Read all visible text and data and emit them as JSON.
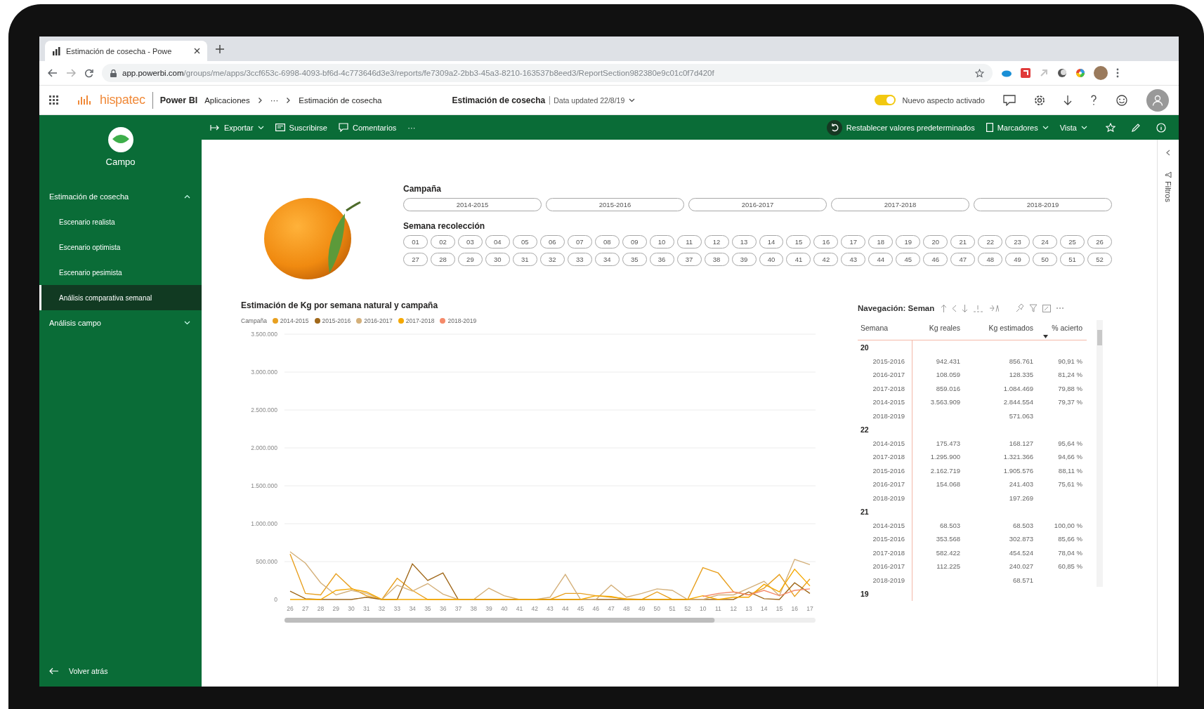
{
  "browser": {
    "tab_title": "Estimación de cosecha - Powe",
    "url_host": "app.powerbi.com",
    "url_path": "/groups/me/apps/3ccf653c-6998-4093-bf6d-4c773646d3e3/reports/fe7309a2-2bb3-45a3-8210-163537b8eed3/ReportSection982380e9c01c0f7d420f"
  },
  "app_bar": {
    "brand": "hispatec",
    "product": "Power BI",
    "breadcrumb": [
      "Aplicaciones",
      "···",
      "Estimación de cosecha"
    ],
    "report_title": "Estimación de cosecha",
    "data_updated": "Data updated 22/8/19",
    "new_look": {
      "label": "Nuevo aspecto activado",
      "on": true
    }
  },
  "toolbar": {
    "left": [
      {
        "label": "Exportar",
        "kind": "export",
        "dropdown": true
      },
      {
        "label": "Suscribirse",
        "kind": "subscribe",
        "dropdown": false
      },
      {
        "label": "Comentarios",
        "kind": "comment",
        "dropdown": false
      },
      {
        "label": "···",
        "kind": "more",
        "dropdown": false
      }
    ],
    "right": [
      {
        "label": "Restablecer valores predeterminados",
        "kind": "reset",
        "dropdown": false
      },
      {
        "label": "Marcadores",
        "kind": "bookmark",
        "dropdown": true
      },
      {
        "label": "Vista",
        "kind": "view",
        "dropdown": true
      }
    ]
  },
  "sidebar": {
    "app_name": "Campo",
    "sections": [
      {
        "label": "Estimación de cosecha",
        "expanded": true,
        "children": [
          {
            "label": "Escenario realista",
            "selected": false
          },
          {
            "label": "Escenario optimista",
            "selected": false
          },
          {
            "label": "Escenario pesimista",
            "selected": false
          },
          {
            "label": "Análisis comparativa semanal",
            "selected": true
          }
        ]
      },
      {
        "label": "Análisis campo",
        "expanded": false
      }
    ],
    "back": "Volver atrás"
  },
  "content": {
    "campaign_slicer": {
      "title": "Campaña",
      "options": [
        {
          "label": "2014-2015",
          "selected": false
        },
        {
          "label": "2015-2016",
          "selected": false
        },
        {
          "label": "2016-2017",
          "selected": false
        },
        {
          "label": "2017-2018",
          "selected": false
        },
        {
          "label": "2018-2019",
          "selected": false
        }
      ]
    },
    "week_slicer": {
      "title": "Semana recolección",
      "options": [
        {
          "label": "01",
          "selected": false
        },
        {
          "label": "02",
          "selected": false
        },
        {
          "label": "03",
          "selected": false
        },
        {
          "label": "04",
          "selected": false
        },
        {
          "label": "05",
          "selected": false
        },
        {
          "label": "06",
          "selected": false
        },
        {
          "label": "07",
          "selected": false
        },
        {
          "label": "08",
          "selected": false
        },
        {
          "label": "09",
          "selected": false
        },
        {
          "label": "10",
          "selected": false
        },
        {
          "label": "11",
          "selected": false
        },
        {
          "label": "12",
          "selected": false
        },
        {
          "label": "13",
          "selected": false
        },
        {
          "label": "14",
          "selected": false
        },
        {
          "label": "15",
          "selected": false
        },
        {
          "label": "16",
          "selected": false
        },
        {
          "label": "17",
          "selected": false
        },
        {
          "label": "18",
          "selected": false
        },
        {
          "label": "19",
          "selected": false
        },
        {
          "label": "20",
          "selected": false
        },
        {
          "label": "21",
          "selected": false
        },
        {
          "label": "22",
          "selected": false
        },
        {
          "label": "23",
          "selected": false
        },
        {
          "label": "24",
          "selected": false
        },
        {
          "label": "25",
          "selected": false
        },
        {
          "label": "26",
          "selected": false
        },
        {
          "label": "27",
          "selected": false
        },
        {
          "label": "28",
          "selected": false
        },
        {
          "label": "29",
          "selected": false
        },
        {
          "label": "30",
          "selected": false
        },
        {
          "label": "31",
          "selected": false
        },
        {
          "label": "32",
          "selected": false
        },
        {
          "label": "33",
          "selected": false
        },
        {
          "label": "34",
          "selected": false
        },
        {
          "label": "35",
          "selected": false
        },
        {
          "label": "36",
          "selected": false
        },
        {
          "label": "37",
          "selected": false
        },
        {
          "label": "38",
          "selected": false
        },
        {
          "label": "39",
          "selected": false
        },
        {
          "label": "40",
          "selected": false
        },
        {
          "label": "41",
          "selected": false
        },
        {
          "label": "42",
          "selected": false
        },
        {
          "label": "43",
          "selected": false
        },
        {
          "label": "44",
          "selected": false
        },
        {
          "label": "45",
          "selected": false
        },
        {
          "label": "46",
          "selected": false
        },
        {
          "label": "47",
          "selected": false
        },
        {
          "label": "48",
          "selected": false
        },
        {
          "label": "49",
          "selected": false
        },
        {
          "label": "50",
          "selected": false
        },
        {
          "label": "51",
          "selected": false
        },
        {
          "label": "52",
          "selected": false
        }
      ]
    },
    "chart": {
      "legend_title": "Campaña",
      "chart_data": {
        "type": "line",
        "grid": true,
        "legend": "top",
        "title": "Estimación de Kg por semana natural y campaña",
        "categories": [
          "26",
          "27",
          "28",
          "29",
          "30",
          "31",
          "32",
          "33",
          "34",
          "35",
          "36",
          "37",
          "38",
          "39",
          "40",
          "41",
          "42",
          "43",
          "44",
          "45",
          "46",
          "47",
          "48",
          "49",
          "50",
          "51",
          "52",
          "10",
          "11",
          "12",
          "13",
          "14",
          "15",
          "16",
          "17"
        ],
        "ylim": [
          0,
          3500000
        ],
        "yticks": [
          {
            "value": 0,
            "label": "0"
          },
          {
            "value": 500000,
            "label": "500.000"
          },
          {
            "value": 1000000,
            "label": "1.000.000"
          },
          {
            "value": 1500000,
            "label": "1.500.000"
          },
          {
            "value": 2000000,
            "label": "2.000.000"
          },
          {
            "value": 2500000,
            "label": "2.500.000"
          },
          {
            "value": 3000000,
            "label": "3.000.000"
          },
          {
            "value": 3500000,
            "label": "3.500.000"
          }
        ],
        "series": [
          {
            "name": "2014-2015",
            "color": "#e8a020",
            "values": [
              600000,
              80000,
              60000,
              340000,
              150000,
              50000,
              0,
              280000,
              120000,
              0,
              0,
              0,
              0,
              0,
              0,
              0,
              0,
              0,
              80000,
              80000,
              50000,
              30000,
              10000,
              0,
              100000,
              0,
              0,
              420000,
              350000,
              100000,
              60000,
              150000,
              330000,
              40000,
              270000
            ]
          },
          {
            "name": "2015-2016",
            "color": "#a0681a",
            "values": [
              110000,
              10000,
              0,
              0,
              0,
              30000,
              0,
              0,
              470000,
              250000,
              350000,
              0,
              0,
              0,
              0,
              0,
              0,
              0,
              0,
              0,
              0,
              0,
              0,
              0,
              0,
              0,
              0,
              0,
              0,
              0,
              100000,
              10000,
              0,
              220000,
              80000
            ]
          },
          {
            "name": "2016-2017",
            "color": "#d4b07a",
            "values": [
              630000,
              480000,
              220000,
              60000,
              120000,
              80000,
              0,
              190000,
              110000,
              210000,
              70000,
              0,
              0,
              150000,
              50000,
              0,
              0,
              30000,
              330000,
              0,
              0,
              190000,
              30000,
              80000,
              140000,
              120000,
              0,
              0,
              60000,
              60000,
              150000,
              240000,
              50000,
              530000,
              460000
            ]
          },
          {
            "name": "2017-2018",
            "color": "#f5a800",
            "values": [
              0,
              0,
              0,
              120000,
              140000,
              100000,
              0,
              0,
              0,
              0,
              0,
              0,
              0,
              0,
              0,
              0,
              0,
              0,
              0,
              0,
              50000,
              40000,
              0,
              0,
              0,
              0,
              0,
              50000,
              0,
              30000,
              30000,
              200000,
              100000,
              400000,
              180000
            ]
          },
          {
            "name": "2018-2019",
            "color": "#f58a6a",
            "values": [
              null,
              null,
              null,
              null,
              null,
              null,
              null,
              null,
              null,
              null,
              null,
              null,
              null,
              null,
              null,
              null,
              null,
              null,
              null,
              null,
              null,
              null,
              null,
              null,
              null,
              null,
              null,
              40000,
              80000,
              100000,
              60000,
              120000,
              50000,
              120000,
              140000
            ]
          }
        ]
      }
    },
    "table": {
      "title": "Navegación: Seman",
      "columns": [
        {
          "label": "Semana",
          "sorted": false
        },
        {
          "label": "Kg reales",
          "sorted": false
        },
        {
          "label": "Kg estimados",
          "sorted": false
        },
        {
          "label": "% acierto",
          "sorted": true
        }
      ],
      "groups": [
        {
          "label": "20",
          "rows": [
            {
              "campaign": "2015-2016",
              "kg_reales": "942.431",
              "kg_estimados": "856.761",
              "acierto": "90,91 %"
            },
            {
              "campaign": "2016-2017",
              "kg_reales": "108.059",
              "kg_estimados": "128.335",
              "acierto": "81,24 %"
            },
            {
              "campaign": "2017-2018",
              "kg_reales": "859.016",
              "kg_estimados": "1.084.469",
              "acierto": "79,88 %"
            },
            {
              "campaign": "2014-2015",
              "kg_reales": "3.563.909",
              "kg_estimados": "2.844.554",
              "acierto": "79,37 %"
            },
            {
              "campaign": "2018-2019",
              "kg_estimados": "571.063"
            }
          ]
        },
        {
          "label": "22",
          "rows": [
            {
              "campaign": "2014-2015",
              "kg_reales": "175.473",
              "kg_estimados": "168.127",
              "acierto": "95,64 %"
            },
            {
              "campaign": "2017-2018",
              "kg_reales": "1.295.900",
              "kg_estimados": "1.321.366",
              "acierto": "94,66 %"
            },
            {
              "campaign": "2015-2016",
              "kg_reales": "2.162.719",
              "kg_estimados": "1.905.576",
              "acierto": "88,11 %"
            },
            {
              "campaign": "2016-2017",
              "kg_reales": "154.068",
              "kg_estimados": "241.403",
              "acierto": "75,61 %"
            },
            {
              "campaign": "2018-2019",
              "kg_estimados": "197.269"
            }
          ]
        },
        {
          "label": "21",
          "rows": [
            {
              "campaign": "2014-2015",
              "kg_reales": "68.503",
              "kg_estimados": "68.503",
              "acierto": "100,00 %"
            },
            {
              "campaign": "2015-2016",
              "kg_reales": "353.568",
              "kg_estimados": "302.873",
              "acierto": "85,66 %"
            },
            {
              "campaign": "2017-2018",
              "kg_reales": "582.422",
              "kg_estimados": "454.524",
              "acierto": "78,04 %"
            },
            {
              "campaign": "2016-2017",
              "kg_reales": "112.225",
              "kg_estimados": "240.027",
              "acierto": "60,85 %"
            },
            {
              "campaign": "2018-2019",
              "kg_estimados": "68.571"
            }
          ]
        },
        {
          "label": "19"
        }
      ]
    }
  },
  "filters_pane": {
    "label": "Filtros"
  }
}
